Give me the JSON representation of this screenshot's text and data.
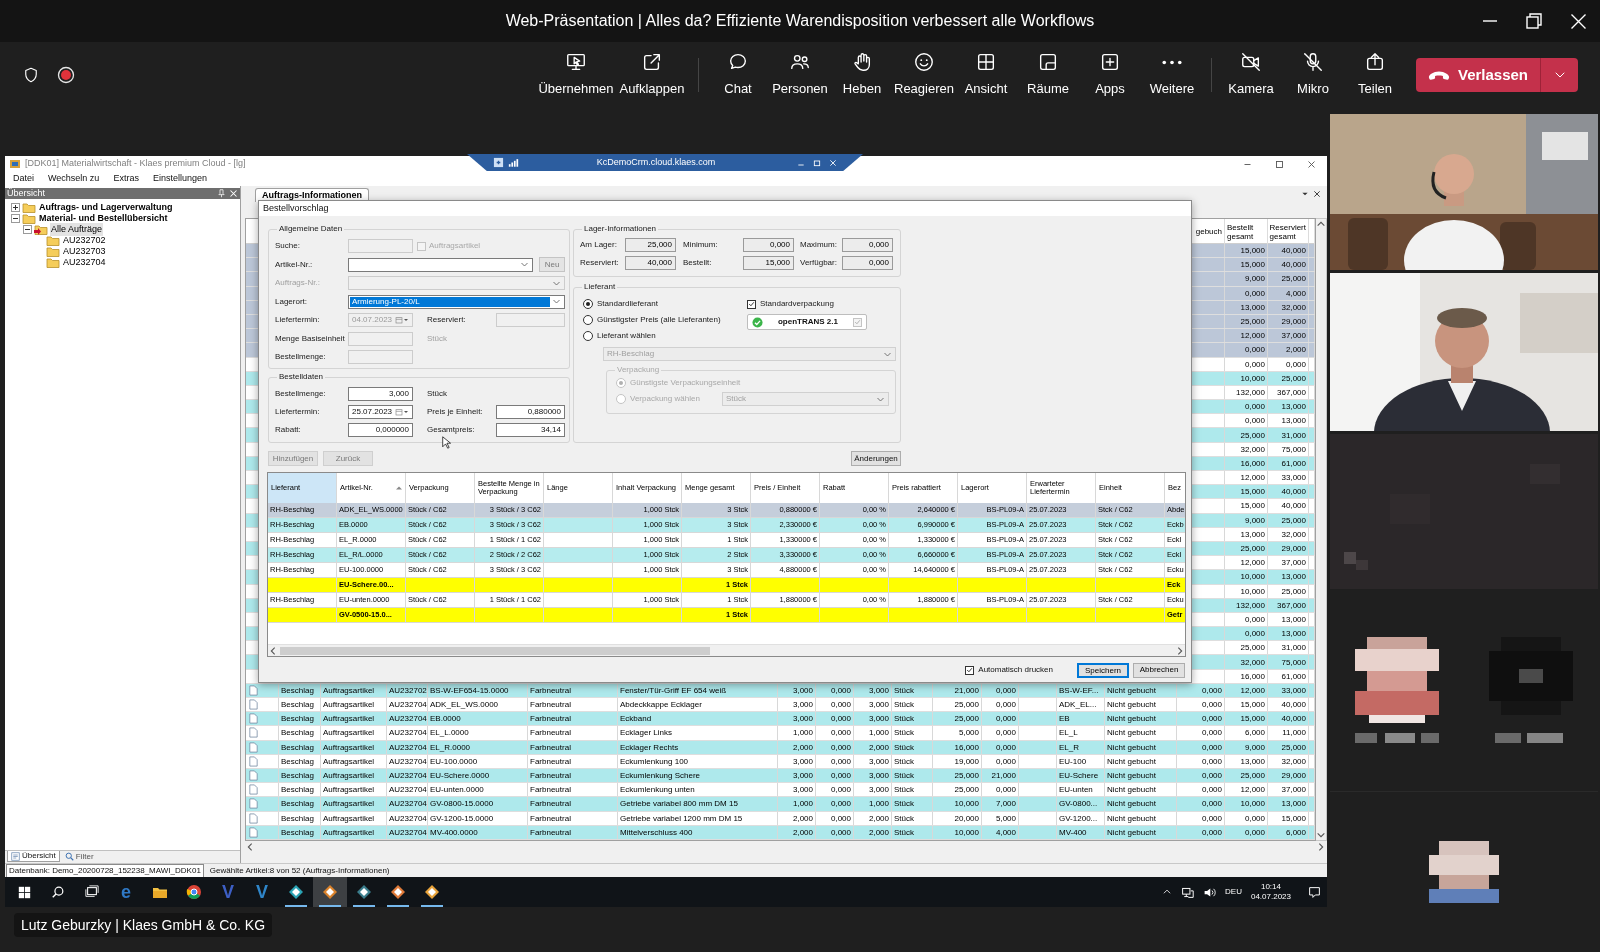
{
  "meeting": {
    "title": "Web-Präsentation | Alles da? Effiziente Warendisposition verbessert alle Workflows"
  },
  "toolbar": {
    "recording": true,
    "action_groups": [
      [
        {
          "label": "Übernehmen",
          "kind": "take-control",
          "off": false
        },
        {
          "label": "Aufklappen",
          "kind": "pop-out",
          "off": false
        }
      ],
      [
        {
          "label": "Chat",
          "kind": "chat",
          "off": false
        },
        {
          "label": "Personen",
          "kind": "people",
          "off": false
        },
        {
          "label": "Heben",
          "kind": "hand",
          "off": false
        },
        {
          "label": "Reagieren",
          "kind": "react",
          "off": false
        },
        {
          "label": "Ansicht",
          "kind": "view",
          "off": false
        },
        {
          "label": "Räume",
          "kind": "rooms",
          "off": false
        },
        {
          "label": "Apps",
          "kind": "apps",
          "off": false
        },
        {
          "label": "Weitere",
          "kind": "more",
          "off": false
        }
      ],
      [
        {
          "label": "Kamera",
          "kind": "camera",
          "off": true
        },
        {
          "label": "Mikro",
          "kind": "mic",
          "off": true
        },
        {
          "label": "Teilen",
          "kind": "share",
          "off": false
        }
      ]
    ],
    "leave_label": "Verlassen"
  },
  "shared_screen": {
    "app_title": "[DDK01] Materialwirtschaft - Klaes premium Cloud - [lg]",
    "remote_host": "KcDemoCrm.cloud.klaes.com",
    "menu": [
      "Datei",
      "Wechseln zu",
      "Extras",
      "Einstellungen"
    ],
    "overview": {
      "title": "Übersicht",
      "tree": [
        {
          "label": "Auftrags- und Lagerverwaltung",
          "kind": "folder",
          "expanded": false,
          "selected": false
        },
        {
          "label": "Material- und Bestellübersicht",
          "kind": "folder",
          "expanded": true,
          "selected": false,
          "children": [
            {
              "label": "Alle Aufträge",
              "kind": "folder-arrow",
              "expanded": true,
              "selected": true,
              "children": [
                {
                  "label": "AU232702",
                  "kind": "folder",
                  "selected": false
                },
                {
                  "label": "AU232703",
                  "kind": "folder",
                  "selected": false
                },
                {
                  "label": "AU232704",
                  "kind": "folder",
                  "selected": false
                }
              ]
            }
          ]
        }
      ],
      "tabs": [
        {
          "label": "Übersicht",
          "selected": true
        },
        {
          "label": "Filter",
          "selected": false
        }
      ]
    },
    "document_tab": "Auftrags-Informationen",
    "grid": {
      "columns": [
        "gebuch",
        "Bestellt gesamt",
        "Reserviert gesamt"
      ],
      "rows": [
        {
          "kind": "selected",
          "bestellt": "15,000",
          "reserviert": "40,000"
        },
        {
          "kind": "selected",
          "bestellt": "15,000",
          "reserviert": "40,000"
        },
        {
          "kind": "selected",
          "bestellt": "9,000",
          "reserviert": "25,000"
        },
        {
          "kind": "selected",
          "bestellt": "0,000",
          "reserviert": "4,000"
        },
        {
          "kind": "selected",
          "bestellt": "13,000",
          "reserviert": "32,000"
        },
        {
          "kind": "selected",
          "bestellt": "25,000",
          "reserviert": "29,000"
        },
        {
          "kind": "selected",
          "bestellt": "12,000",
          "reserviert": "37,000"
        },
        {
          "kind": "selected",
          "bestellt": "0,000",
          "reserviert": "2,000"
        },
        {
          "kind": "plain",
          "bestellt": "0,000",
          "reserviert": "0,000"
        },
        {
          "kind": "alt",
          "bestellt": "10,000",
          "reserviert": "25,000"
        },
        {
          "kind": "plain",
          "bestellt": "132,000",
          "reserviert": "367,000"
        },
        {
          "kind": "alt",
          "bestellt": "0,000",
          "reserviert": "13,000"
        },
        {
          "kind": "plain",
          "bestellt": "0,000",
          "reserviert": "13,000"
        },
        {
          "kind": "alt",
          "bestellt": "25,000",
          "reserviert": "31,000"
        },
        {
          "kind": "plain",
          "bestellt": "32,000",
          "reserviert": "75,000"
        },
        {
          "kind": "alt",
          "bestellt": "16,000",
          "reserviert": "61,000"
        },
        {
          "kind": "plain",
          "bestellt": "12,000",
          "reserviert": "33,000"
        },
        {
          "kind": "alt",
          "bestellt": "15,000",
          "reserviert": "40,000"
        },
        {
          "kind": "plain",
          "bestellt": "15,000",
          "reserviert": "40,000"
        },
        {
          "kind": "alt",
          "bestellt": "9,000",
          "reserviert": "25,000"
        },
        {
          "kind": "plain",
          "bestellt": "13,000",
          "reserviert": "32,000"
        },
        {
          "kind": "alt",
          "bestellt": "25,000",
          "reserviert": "29,000"
        },
        {
          "kind": "plain",
          "bestellt": "12,000",
          "reserviert": "37,000"
        },
        {
          "kind": "alt",
          "bestellt": "10,000",
          "reserviert": "13,000"
        },
        {
          "kind": "plain",
          "bestellt": "10,000",
          "reserviert": "25,000"
        },
        {
          "kind": "alt",
          "bestellt": "132,000",
          "reserviert": "367,000"
        },
        {
          "kind": "plain",
          "bestellt": "0,000",
          "reserviert": "13,000"
        },
        {
          "kind": "alt",
          "bestellt": "0,000",
          "reserviert": "13,000"
        },
        {
          "kind": "plain",
          "bestellt": "25,000",
          "reserviert": "31,000"
        },
        {
          "kind": "alt",
          "bestellt": "32,000",
          "reserviert": "75,000"
        },
        {
          "kind": "plain",
          "bestellt": "16,000",
          "reserviert": "61,000"
        },
        {
          "kind": "alt",
          "details": [
            "Beschlag",
            "Auftragsartikel",
            "AU232702",
            "BS-W-EF654-15.0000",
            "Farbneutral",
            "Fenster/Tür-Griff EF 654 weiß",
            "3,000",
            "0,000",
            "3,000",
            "Stück",
            "21,000",
            "0,000",
            "BS-W-EF...",
            "Nicht gebucht",
            "0,000"
          ],
          "bestellt": "12,000",
          "reserviert": "33,000"
        },
        {
          "kind": "plain",
          "details": [
            "Beschlag",
            "Auftragsartikel",
            "AU232704",
            "ADK_EL_WS.0000",
            "Farbneutral",
            "Abdeckkappe Ecklager",
            "3,000",
            "0,000",
            "3,000",
            "Stück",
            "25,000",
            "0,000",
            "ADK_EL...",
            "Nicht gebucht",
            "0,000"
          ],
          "bestellt": "15,000",
          "reserviert": "40,000"
        },
        {
          "kind": "alt",
          "details": [
            "Beschlag",
            "Auftragsartikel",
            "AU232704",
            "EB.0000",
            "Farbneutral",
            "Eckband",
            "3,000",
            "0,000",
            "3,000",
            "Stück",
            "25,000",
            "0,000",
            "EB",
            "Nicht gebucht",
            "0,000"
          ],
          "bestellt": "15,000",
          "reserviert": "40,000"
        },
        {
          "kind": "plain",
          "details": [
            "Beschlag",
            "Auftragsartikel",
            "AU232704",
            "EL_L.0000",
            "Farbneutral",
            "Ecklager Links",
            "1,000",
            "0,000",
            "1,000",
            "Stück",
            "5,000",
            "0,000",
            "EL_L",
            "Nicht gebucht",
            "0,000"
          ],
          "bestellt": "6,000",
          "reserviert": "11,000"
        },
        {
          "kind": "alt",
          "details": [
            "Beschlag",
            "Auftragsartikel",
            "AU232704",
            "EL_R.0000",
            "Farbneutral",
            "Ecklager Rechts",
            "2,000",
            "0,000",
            "2,000",
            "Stück",
            "16,000",
            "0,000",
            "EL_R",
            "Nicht gebucht",
            "0,000"
          ],
          "bestellt": "9,000",
          "reserviert": "25,000"
        },
        {
          "kind": "plain",
          "details": [
            "Beschlag",
            "Auftragsartikel",
            "AU232704",
            "EU-100.0000",
            "Farbneutral",
            "Eckumlenkung 100",
            "3,000",
            "0,000",
            "3,000",
            "Stück",
            "19,000",
            "0,000",
            "EU-100",
            "Nicht gebucht",
            "0,000"
          ],
          "bestellt": "13,000",
          "reserviert": "32,000"
        },
        {
          "kind": "alt",
          "details": [
            "Beschlag",
            "Auftragsartikel",
            "AU232704",
            "EU-Schere.0000",
            "Farbneutral",
            "Eckumlenkung Schere",
            "3,000",
            "0,000",
            "3,000",
            "Stück",
            "25,000",
            "21,000",
            "EU-Schere",
            "Nicht gebucht",
            "0,000"
          ],
          "bestellt": "25,000",
          "reserviert": "29,000"
        },
        {
          "kind": "plain",
          "details": [
            "Beschlag",
            "Auftragsartikel",
            "AU232704",
            "EU-unten.0000",
            "Farbneutral",
            "Eckumlenkung unten",
            "3,000",
            "0,000",
            "3,000",
            "Stück",
            "25,000",
            "0,000",
            "EU-unten",
            "Nicht gebucht",
            "0,000"
          ],
          "bestellt": "12,000",
          "reserviert": "37,000"
        },
        {
          "kind": "alt",
          "details": [
            "Beschlag",
            "Auftragsartikel",
            "AU232704",
            "GV-0800-15.0000",
            "Farbneutral",
            "Getriebe variabel  800 mm DM 15",
            "1,000",
            "0,000",
            "1,000",
            "Stück",
            "10,000",
            "7,000",
            "GV-0800...",
            "Nicht gebucht",
            "0,000"
          ],
          "bestellt": "10,000",
          "reserviert": "13,000"
        },
        {
          "kind": "plain",
          "details": [
            "Beschlag",
            "Auftragsartikel",
            "AU232704",
            "GV-1200-15.0000",
            "Farbneutral",
            "Getriebe variabel 1200 mm DM 15",
            "2,000",
            "0,000",
            "2,000",
            "Stück",
            "20,000",
            "5,000",
            "GV-1200...",
            "Nicht gebucht",
            "0,000"
          ],
          "bestellt": "0,000",
          "reserviert": "15,000"
        },
        {
          "kind": "alt",
          "details": [
            "Beschlag",
            "Auftragsartikel",
            "AU232704",
            "MV-400.0000",
            "Farbneutral",
            "Mittelverschluss 400",
            "2,000",
            "0,000",
            "2,000",
            "Stück",
            "10,000",
            "4,000",
            "MV-400",
            "Nicht gebucht",
            "0,000"
          ],
          "bestellt": "0,000",
          "reserviert": "6,000"
        }
      ]
    },
    "dialog": {
      "title": "Bestellvorschlag",
      "general": {
        "title": "Allgemeine Daten",
        "rows": [
          [
            {
              "kind": "label",
              "text": "Suche:",
              "disabled": false
            },
            {
              "kind": "field",
              "disabled": true
            },
            {
              "kind": "checkbox",
              "label": "Auftragsartikel",
              "checked": false,
              "disabled": true
            }
          ],
          [
            {
              "kind": "label",
              "text": "Artikel-Nr.:",
              "disabled": false
            },
            {
              "kind": "combo",
              "disabled": false
            },
            {
              "kind": "button",
              "label": "Neu",
              "disabled": true
            }
          ],
          [
            {
              "kind": "label",
              "text": "Auftrags-Nr.:",
              "disabled": true
            },
            {
              "kind": "combo",
              "disabled": true
            }
          ],
          [
            {
              "kind": "label",
              "text": "Lagerort:",
              "disabled": false
            },
            {
              "kind": "combo",
              "value": "Armierung-PL-20/L",
              "disabled": false,
              "highlighted": true
            }
          ],
          [
            {
              "kind": "label",
              "text": "Liefertermin:",
              "disabled": false
            },
            {
              "kind": "date",
              "value": "04.07.2023",
              "disabled": true
            },
            {
              "kind": "label",
              "text": "Reserviert:",
              "disabled": false
            },
            {
              "kind": "field",
              "disabled": true
            }
          ],
          [
            {
              "kind": "label",
              "text": "Menge Basiseinheit",
              "disabled": false
            },
            {
              "kind": "field",
              "disabled": true
            },
            {
              "kind": "label",
              "text": "Stück",
              "disabled": true
            }
          ],
          [
            {
              "kind": "label",
              "text": "Bestellmenge:",
              "disabled": false
            },
            {
              "kind": "field",
              "disabled": true
            }
          ]
        ]
      },
      "order": {
        "title": "Bestelldaten",
        "rows": [
          [
            {
              "kind": "label",
              "text": "Bestellmenge:",
              "disabled": false
            },
            {
              "kind": "number",
              "value": "3,000",
              "disabled": false
            },
            {
              "kind": "label",
              "text": "Stück",
              "disabled": false
            }
          ],
          [
            {
              "kind": "label",
              "text": "Liefertermin:",
              "disabled": false
            },
            {
              "kind": "date",
              "value": "25.07.2023",
              "disabled": false
            },
            {
              "kind": "label",
              "text": "Preis je Einheit:",
              "disabled": false
            },
            {
              "kind": "number",
              "value": "0,880000",
              "disabled": false
            }
          ],
          [
            {
              "kind": "label",
              "text": "Rabatt:",
              "disabled": false
            },
            {
              "kind": "number",
              "value": "0,000000",
              "disabled": false
            },
            {
              "kind": "label",
              "text": "Gesamtpreis:",
              "disabled": false
            },
            {
              "kind": "number",
              "value": "34,14",
              "disabled": false
            }
          ]
        ]
      },
      "stock": {
        "title": "Lager-Informationen",
        "rows": [
          [
            {
              "label": "Am Lager:",
              "value": "25,000"
            },
            {
              "label": "Minimum:",
              "value": "0,000"
            },
            {
              "label": "Maximum:",
              "value": "0,000"
            }
          ],
          [
            {
              "label": "Reserviert:",
              "value": "40,000"
            },
            {
              "label": "Bestellt:",
              "value": "15,000"
            },
            {
              "label": "Verfügbar:",
              "value": "0,000"
            }
          ]
        ]
      },
      "supplier": {
        "title": "Lieferant",
        "options": [
          {
            "label": "Standardlieferant",
            "selected": true
          },
          {
            "label": "Günstigster Preis (alle Lieferanten)",
            "selected": false
          },
          {
            "label": "Lieferant wählen",
            "selected": false
          }
        ],
        "standard_packaging": {
          "label": "Standardverpackung",
          "checked": true
        },
        "opentrans": {
          "label": "openTRANS 2.1",
          "valid": true,
          "checked": true
        },
        "supplier_select": {
          "value": "RH-Beschlag",
          "disabled": true
        },
        "packaging": {
          "title": "Verpackung",
          "disabled": true,
          "options": [
            {
              "label": "Günstigste Verpackungseinheit",
              "selected": true
            },
            {
              "label": "Verpackung wählen",
              "selected": false
            }
          ],
          "unit_select": {
            "value": "Stück"
          }
        }
      },
      "actions": [
        {
          "label": "Hinzufügen",
          "disabled": true
        },
        {
          "label": "Zurück",
          "disabled": true
        },
        {
          "label": "Änderungen",
          "disabled": false
        }
      ],
      "table": {
        "columns": [
          {
            "label": "Lieferant",
            "selected": true,
            "sorted": false
          },
          {
            "label": "Artikel-Nr.",
            "selected": false,
            "sorted": true
          },
          {
            "label": "Verpackung",
            "selected": false,
            "sorted": false
          },
          {
            "label": "Bestellte Menge in Verpackung",
            "selected": false,
            "sorted": false
          },
          {
            "label": "Länge",
            "selected": false,
            "sorted": false
          },
          {
            "label": "Inhalt Verpackung",
            "selected": false,
            "sorted": false
          },
          {
            "label": "Menge gesamt",
            "selected": false,
            "sorted": false
          },
          {
            "label": "Preis / Einheit",
            "selected": false,
            "sorted": false
          },
          {
            "label": "Rabatt",
            "selected": false,
            "sorted": false
          },
          {
            "label": "Preis rabattiert",
            "selected": false,
            "sorted": false
          },
          {
            "label": "Lagerort",
            "selected": false,
            "sorted": false
          },
          {
            "label": "Erwarteter Liefertermin",
            "selected": false,
            "sorted": false
          },
          {
            "label": "Einheit",
            "selected": false,
            "sorted": false
          },
          {
            "label": "Bez",
            "selected": false,
            "sorted": false
          }
        ],
        "rows": [
          {
            "kind": "selected",
            "cells": {
              "lieferant": "RH-Beschlag",
              "artikel": "ADK_EL_WS.0000",
              "verpackung": "Stück / C62",
              "menge_verpackung": "3 Stück / 3 C62",
              "inhalt": "1,000 Stck",
              "menge_gesamt": "3 Stck",
              "preis": "0,880000 €",
              "rabatt": "0,00 %",
              "preis_rabattiert": "2,640000 €",
              "lagerort": "BS-PL09-A",
              "liefertermin": "25.07.2023",
              "einheit": "Stck / C62",
              "bez": "Abde"
            }
          },
          {
            "kind": "alt",
            "cells": {
              "lieferant": "RH-Beschlag",
              "artikel": "EB.0000",
              "verpackung": "Stück / C62",
              "menge_verpackung": "3 Stück / 3 C62",
              "inhalt": "1,000 Stck",
              "menge_gesamt": "3 Stck",
              "preis": "2,330000 €",
              "rabatt": "0,00 %",
              "preis_rabattiert": "6,990000 €",
              "lagerort": "BS-PL09-A",
              "liefertermin": "25.07.2023",
              "einheit": "Stck / C62",
              "bez": "Eckb"
            }
          },
          {
            "kind": "plain",
            "cells": {
              "lieferant": "RH-Beschlag",
              "artikel": "EL_R.0000",
              "verpackung": "Stück / C62",
              "menge_verpackung": "1 Stück / 1 C62",
              "inhalt": "1,000 Stck",
              "menge_gesamt": "1 Stck",
              "preis": "1,330000 €",
              "rabatt": "0,00 %",
              "preis_rabattiert": "1,330000 €",
              "lagerort": "BS-PL09-A",
              "liefertermin": "25.07.2023",
              "einheit": "Stck / C62",
              "bez": "Eckl"
            }
          },
          {
            "kind": "alt",
            "cells": {
              "lieferant": "RH-Beschlag",
              "artikel": "EL_R/L.0000",
              "verpackung": "Stück / C62",
              "menge_verpackung": "2 Stück / 2 C62",
              "inhalt": "1,000 Stck",
              "menge_gesamt": "2 Stck",
              "preis": "3,330000 €",
              "rabatt": "0,00 %",
              "preis_rabattiert": "6,660000 €",
              "lagerort": "BS-PL09-A",
              "liefertermin": "25.07.2023",
              "einheit": "Stck / C62",
              "bez": "Eckl"
            }
          },
          {
            "kind": "plain",
            "cells": {
              "lieferant": "RH-Beschlag",
              "artikel": "EU-100.0000",
              "verpackung": "Stück / C62",
              "menge_verpackung": "3 Stück / 3 C62",
              "inhalt": "1,000 Stck",
              "menge_gesamt": "3 Stck",
              "preis": "4,880000 €",
              "rabatt": "0,00 %",
              "preis_rabattiert": "14,640000 €",
              "lagerort": "BS-PL09-A",
              "liefertermin": "25.07.2023",
              "einheit": "Stck / C62",
              "bez": "Ecku"
            }
          },
          {
            "kind": "warning",
            "cells": {
              "artikel": "EU-Schere.00...",
              "menge_gesamt": "1 Stck",
              "bez": "Eck"
            }
          },
          {
            "kind": "plain",
            "cells": {
              "lieferant": "RH-Beschlag",
              "artikel": "EU-unten.0000",
              "verpackung": "Stück / C62",
              "menge_verpackung": "1 Stück / 1 C62",
              "inhalt": "1,000 Stck",
              "menge_gesamt": "1 Stck",
              "preis": "1,880000 €",
              "rabatt": "0,00 %",
              "preis_rabattiert": "1,880000 €",
              "lagerort": "BS-PL09-A",
              "liefertermin": "25.07.2023",
              "einheit": "Stck / C62",
              "bez": "Ecku"
            }
          },
          {
            "kind": "warning",
            "cells": {
              "artikel": "GV-0500-15.0...",
              "menge_gesamt": "1 Stck",
              "bez": "Getr"
            }
          }
        ]
      },
      "footer": {
        "auto_print": {
          "label": "Automatisch drucken",
          "checked": true
        },
        "buttons": [
          {
            "label": "Speichern",
            "focused": true
          },
          {
            "label": "Abbrechen",
            "focused": false
          }
        ]
      }
    },
    "status_bar": [
      "Datenbank: Demo_20200728_152238_MAWI_DDK01",
      "Gewählte Artikel:8 von 52 (Auftrags-Informationen)"
    ],
    "taskbar": {
      "items": [
        {
          "kind": "start",
          "running": false,
          "active": false
        },
        {
          "kind": "search",
          "running": false,
          "active": false
        },
        {
          "kind": "task-view",
          "running": false,
          "active": false
        },
        {
          "kind": "glyph",
          "glyph": "e",
          "color": "#2f78c4",
          "running": false,
          "active": false
        },
        {
          "kind": "folder",
          "running": false,
          "active": false
        },
        {
          "kind": "chrome",
          "running": false,
          "active": false
        },
        {
          "kind": "glyph",
          "glyph": "V",
          "color": "#3d5fc4",
          "running": false,
          "active": false
        },
        {
          "kind": "glyph",
          "glyph": "V",
          "color": "#2f86c9",
          "running": false,
          "active": false
        },
        {
          "kind": "app",
          "color": "#2aa3b4",
          "running": true,
          "active": false
        },
        {
          "kind": "app",
          "color": "#d9822b",
          "running": true,
          "active": true
        },
        {
          "kind": "app",
          "color": "#3a7d8c",
          "running": true,
          "active": false
        },
        {
          "kind": "app",
          "color": "#e07b39",
          "running": true,
          "active": false
        },
        {
          "kind": "app",
          "color": "#e8a33a",
          "running": true,
          "active": false
        }
      ],
      "language": "DEU",
      "time": "10:14",
      "date": "04.07.2023"
    }
  },
  "presenter": "Lutz Geburzky | Klaes GmbH & Co. KG"
}
